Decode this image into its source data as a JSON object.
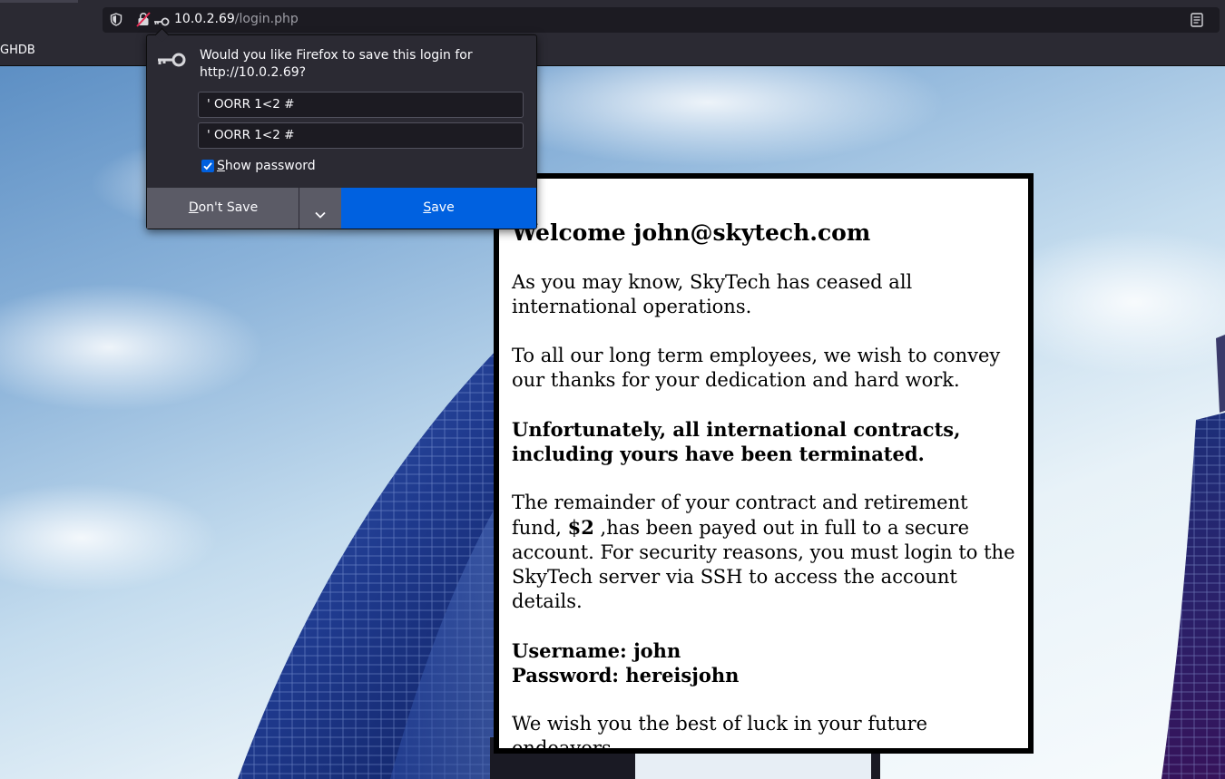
{
  "browser": {
    "url": {
      "host": "10.0.2.69",
      "path": "/login.php"
    },
    "bookmarks": [
      {
        "label": "GHDB"
      }
    ],
    "icons": {
      "tracking": "shield-icon",
      "insecure": "crossed-lock-icon",
      "login": "key-icon",
      "reader": "reader-view-icon"
    }
  },
  "save_login_popup": {
    "message": "Would you like Firefox to save this login for http://10.0.2.69?",
    "username": "' OORR 1<2 #",
    "password": "' OORR 1<2 #",
    "show_password": {
      "checked": true,
      "label_key": "S",
      "label_rest": "how password"
    },
    "dont_save": {
      "key": "D",
      "rest": "on't Save"
    },
    "save": {
      "key": "S",
      "rest": "ave"
    },
    "accent_color": "#0061e0"
  },
  "page": {
    "title": "Welcome john@skytech.com",
    "paragraph_1": "As you may know, SkyTech has ceased all international operations.",
    "paragraph_2": "To all our long term employees, we wish to convey our thanks for your dedication and hard work.",
    "paragraph_3": "Unfortunately, all international contracts, including yours have been terminated.",
    "paragraph_4": {
      "before": "The remainder of your contract and retirement fund, ",
      "amount": "$2",
      "after": " ,has been payed out in full to a secure account. For security reasons, you must login to the SkyTech server via SSH to access the account details."
    },
    "credentials": {
      "username_line": "Username: john",
      "password_line": "Password: hereisjohn"
    },
    "closing": "We wish you the best of luck in your future endeavors."
  }
}
